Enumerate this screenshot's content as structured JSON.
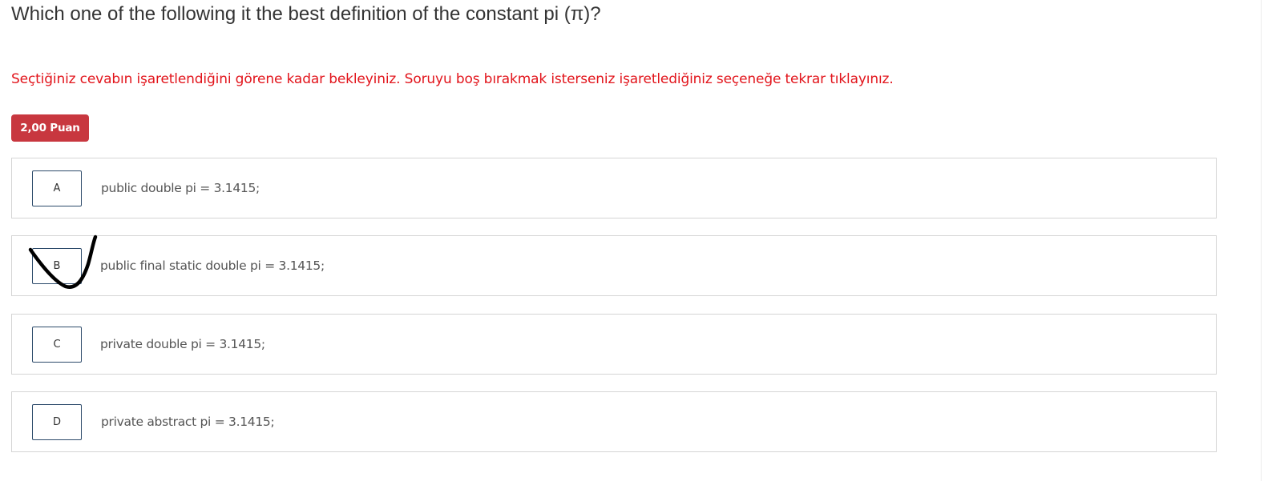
{
  "question": {
    "title": "Which one of the following it the best definition of the constant pi (π)?",
    "instruction": "Seçtiğiniz cevabın işaretlendiğini görene kadar bekleyiniz. Soruyu boş bırakmak isterseniz işaretlediğiniz seçeneğe tekrar tıklayınız.",
    "points": "2,00 Puan"
  },
  "options": [
    {
      "letter": "A",
      "text": "public double pi = 3.1415;"
    },
    {
      "letter": "B",
      "text": "public final static double pi = 3.1415;"
    },
    {
      "letter": "C",
      "text": "private double pi = 3.1415;"
    },
    {
      "letter": "D",
      "text": "private abstract pi = 3.1415;"
    }
  ],
  "selected_option": "B",
  "mark_icon": "hand-drawn-checkmark-icon",
  "colors": {
    "instruction": "#e2141b",
    "badge": "#c8373f",
    "letter_border": "#2c4a6a",
    "option_border": "#d5d5d5"
  }
}
